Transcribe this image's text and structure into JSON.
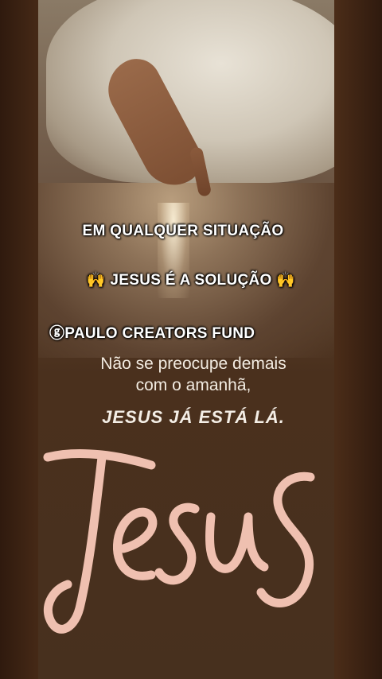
{
  "overlay": {
    "line1": "EM QUALQUER SITUAÇÃO",
    "line2_emoji_left": "🙌",
    "line2_text": "JESUS É A SOLUÇÃO",
    "line2_emoji_right": "🙌",
    "line3": "ⓖPAULO CREATORS FUND"
  },
  "quote": {
    "line1": "Não se preocupe demais",
    "line2": "com o amanhã,",
    "line3": "JESUS JÁ ESTÁ LÁ."
  },
  "logo_text": "Jesus",
  "colors": {
    "script": "#efc0b0",
    "background": "#3a2213"
  }
}
